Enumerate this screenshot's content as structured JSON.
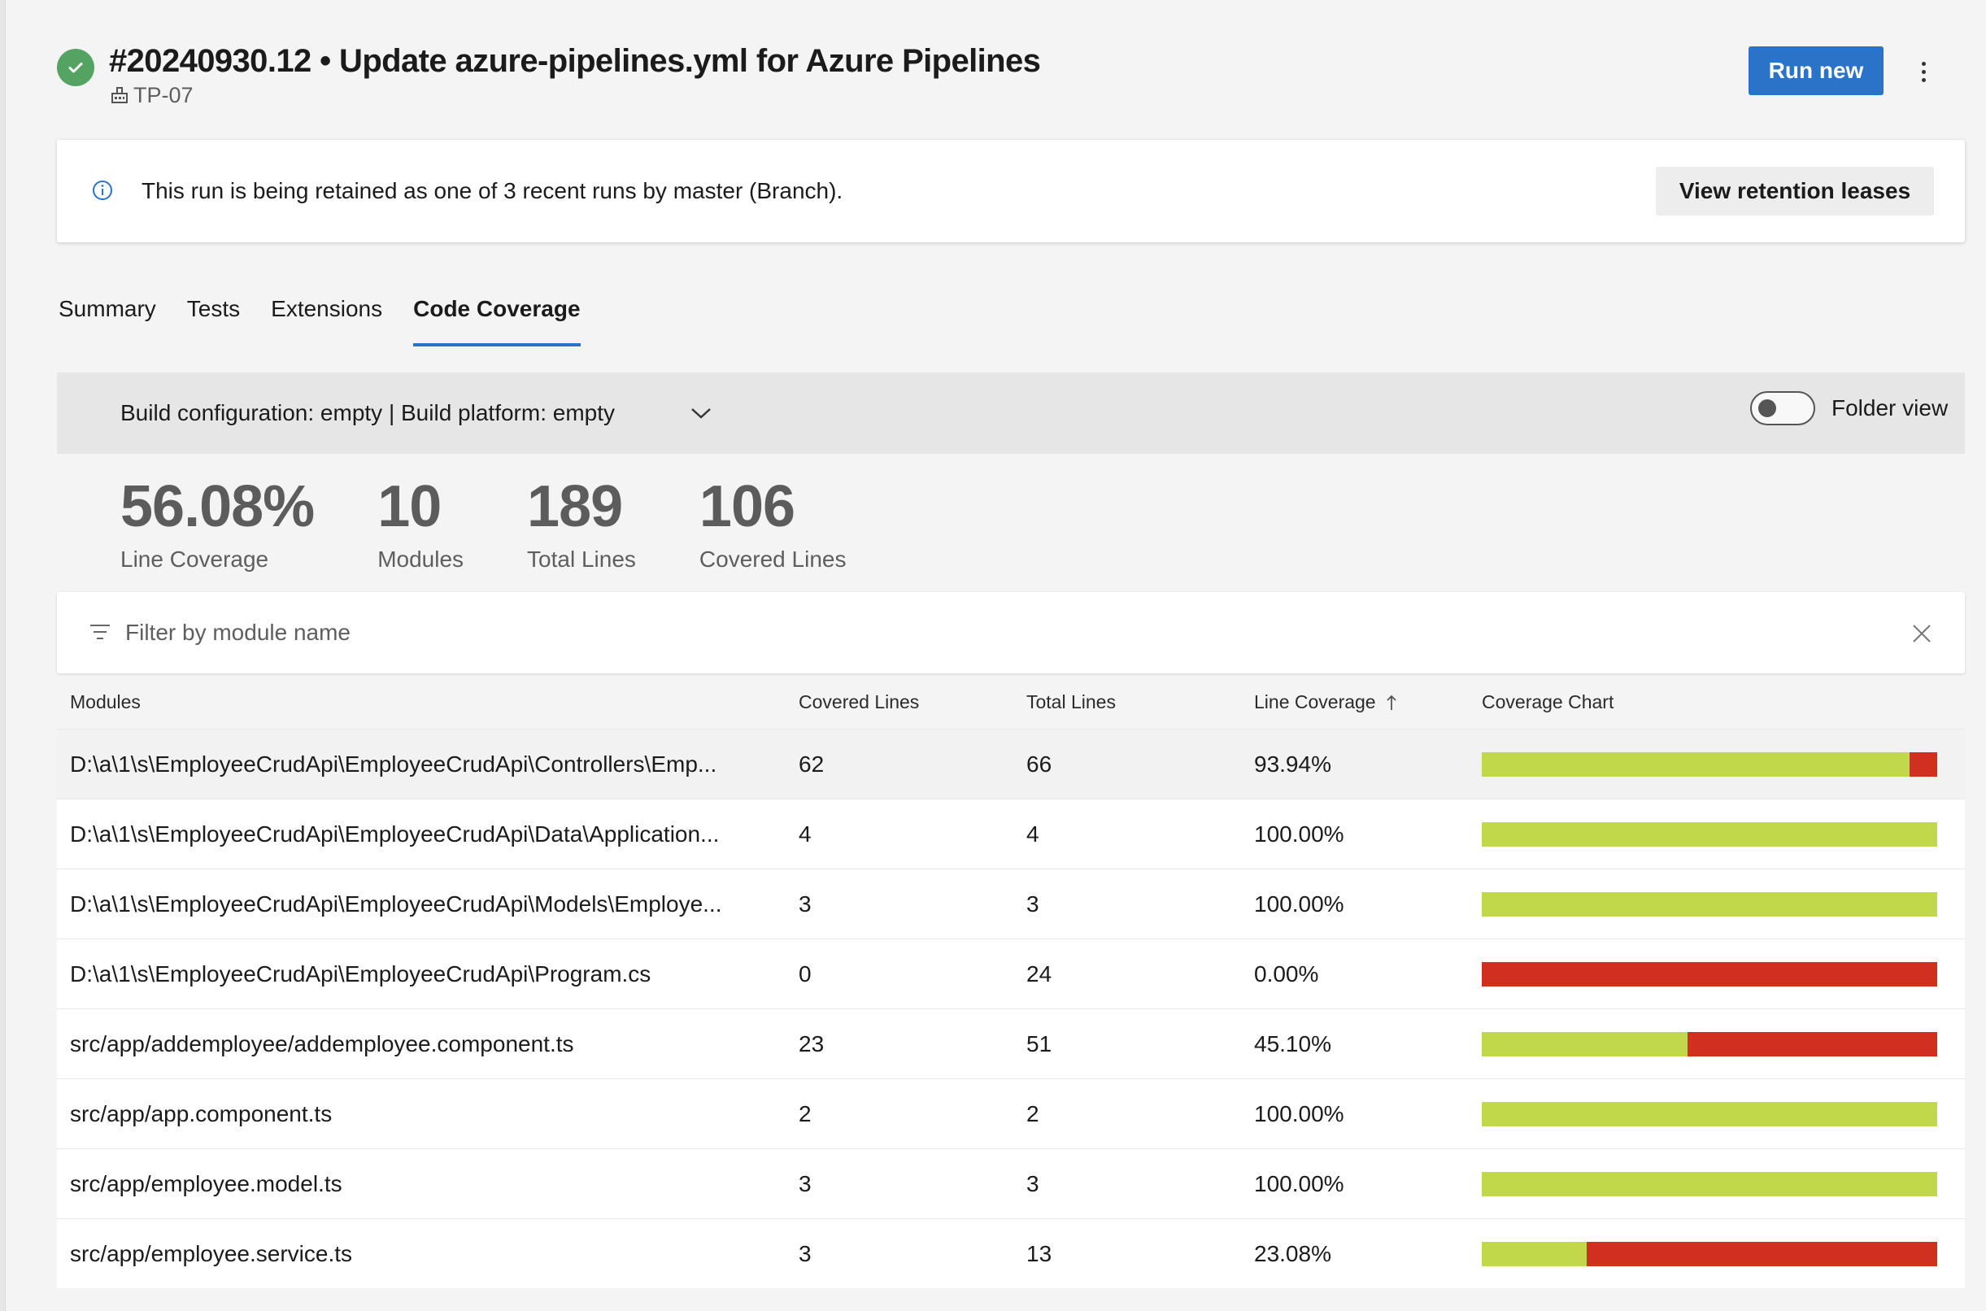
{
  "header": {
    "title": "#20240930.12 • Update azure-pipelines.yml for Azure Pipelines",
    "agent": "TP-07",
    "run_new_label": "Run new"
  },
  "banner": {
    "text": "This run is being retained as one of 3 recent runs by master (Branch).",
    "button_label": "View retention leases"
  },
  "tabs": [
    {
      "label": "Summary",
      "active": false
    },
    {
      "label": "Tests",
      "active": false
    },
    {
      "label": "Extensions",
      "active": false
    },
    {
      "label": "Code Coverage",
      "active": true
    }
  ],
  "config": {
    "selected": "Build configuration: empty | Build platform: empty",
    "folder_view_label": "Folder view",
    "folder_view_on": false
  },
  "stats": [
    {
      "value": "56.08%",
      "label": "Line Coverage"
    },
    {
      "value": "10",
      "label": "Modules"
    },
    {
      "value": "189",
      "label": "Total Lines"
    },
    {
      "value": "106",
      "label": "Covered Lines"
    }
  ],
  "filter": {
    "placeholder": "Filter by module name"
  },
  "table": {
    "columns": [
      "Modules",
      "Covered Lines",
      "Total Lines",
      "Line Coverage",
      "Coverage Chart"
    ],
    "rows": [
      {
        "module": "D:\\a\\1\\s\\EmployeeCrudApi\\EmployeeCrudApi\\Controllers\\Emp...",
        "covered": "62",
        "total": "66",
        "coverage": "93.94%",
        "fraction": 0.9394
      },
      {
        "module": "D:\\a\\1\\s\\EmployeeCrudApi\\EmployeeCrudApi\\Data\\Application...",
        "covered": "4",
        "total": "4",
        "coverage": "100.00%",
        "fraction": 1.0
      },
      {
        "module": "D:\\a\\1\\s\\EmployeeCrudApi\\EmployeeCrudApi\\Models\\Employe...",
        "covered": "3",
        "total": "3",
        "coverage": "100.00%",
        "fraction": 1.0
      },
      {
        "module": "D:\\a\\1\\s\\EmployeeCrudApi\\EmployeeCrudApi\\Program.cs",
        "covered": "0",
        "total": "24",
        "coverage": "0.00%",
        "fraction": 0.0
      },
      {
        "module": "src/app/addemployee/addemployee.component.ts",
        "covered": "23",
        "total": "51",
        "coverage": "45.10%",
        "fraction": 0.451
      },
      {
        "module": "src/app/app.component.ts",
        "covered": "2",
        "total": "2",
        "coverage": "100.00%",
        "fraction": 1.0
      },
      {
        "module": "src/app/employee.model.ts",
        "covered": "3",
        "total": "3",
        "coverage": "100.00%",
        "fraction": 1.0
      },
      {
        "module": "src/app/employee.service.ts",
        "covered": "3",
        "total": "13",
        "coverage": "23.08%",
        "fraction": 0.2308
      }
    ]
  },
  "colors": {
    "accent": "#2b72c9",
    "success": "#55a362",
    "covered": "#c0d84a",
    "uncovered": "#d12f1f"
  }
}
